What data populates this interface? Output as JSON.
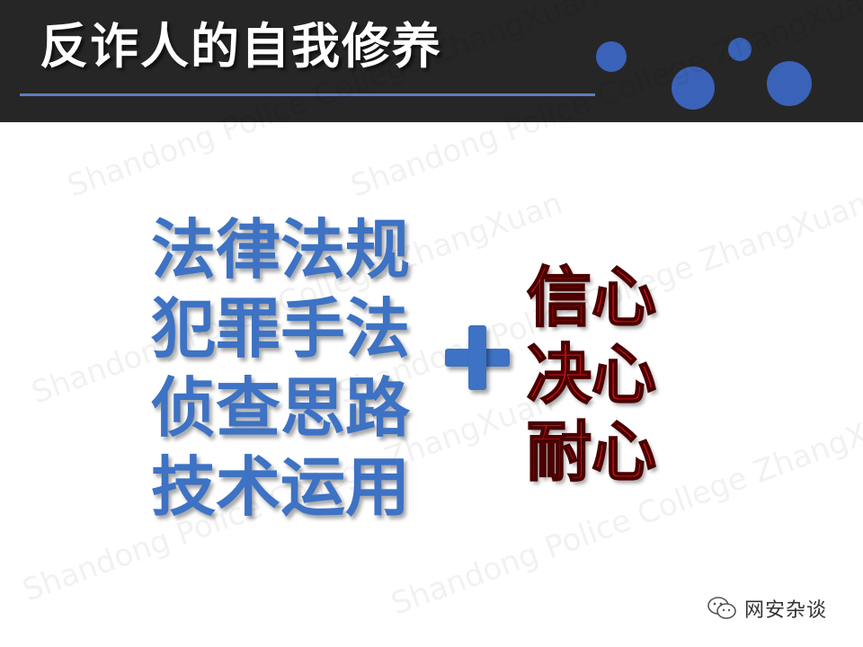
{
  "slide": {
    "title": "反诈人的自我修养",
    "watermark": "Shandong Police College ZhangXuan",
    "left_items": [
      "法律法规",
      "犯罪手法",
      "侦查思路",
      "技术运用"
    ],
    "plus_symbol": "+",
    "right_items": [
      "信心",
      "决心",
      "耐心"
    ],
    "brand_label": "网安杂谈"
  },
  "colors": {
    "header_bg": "#262626",
    "accent_blue": "#3d72c4",
    "emphasis_red": "#d2141b"
  },
  "icons": [
    "wechat-icon"
  ]
}
